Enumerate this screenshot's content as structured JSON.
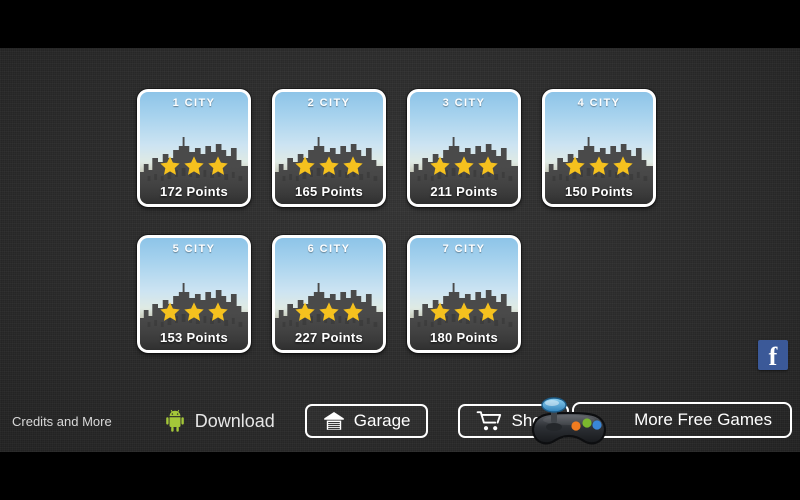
{
  "screen": {
    "background_color": "#2b2b2b",
    "letterbox_color": "#000000"
  },
  "levels": {
    "star_color": "#f5c11e",
    "card_border_color": "#ffffff",
    "points_suffix": "Points",
    "items": [
      {
        "number": "1",
        "title": "1  CITY",
        "points": "172",
        "points_label": "172  Points",
        "stars": 3,
        "max_stars": 3
      },
      {
        "number": "2",
        "title": "2  CITY",
        "points": "165",
        "points_label": "165  Points",
        "stars": 3,
        "max_stars": 3
      },
      {
        "number": "3",
        "title": "3  CITY",
        "points": "211",
        "points_label": "211  Points",
        "stars": 3,
        "max_stars": 3
      },
      {
        "number": "4",
        "title": "4  CITY",
        "points": "150",
        "points_label": "150  Points",
        "stars": 3,
        "max_stars": 3
      },
      {
        "number": "5",
        "title": "5  CITY",
        "points": "153",
        "points_label": "153  Points",
        "stars": 3,
        "max_stars": 3
      },
      {
        "number": "6",
        "title": "6  CITY",
        "points": "227",
        "points_label": "227  Points",
        "stars": 3,
        "max_stars": 3
      },
      {
        "number": "7",
        "title": "7  CITY",
        "points": "180",
        "points_label": "180  Points",
        "stars": 3,
        "max_stars": 3
      }
    ]
  },
  "social": {
    "facebook_glyph": "f",
    "facebook_color": "#3b5998"
  },
  "toolbar": {
    "credits_label": "Credits and More",
    "download_label": "Download",
    "android_color": "#a4c739",
    "garage_label": "Garage",
    "shop_label": "Shop",
    "more_free_games_label": "More Free Games"
  }
}
